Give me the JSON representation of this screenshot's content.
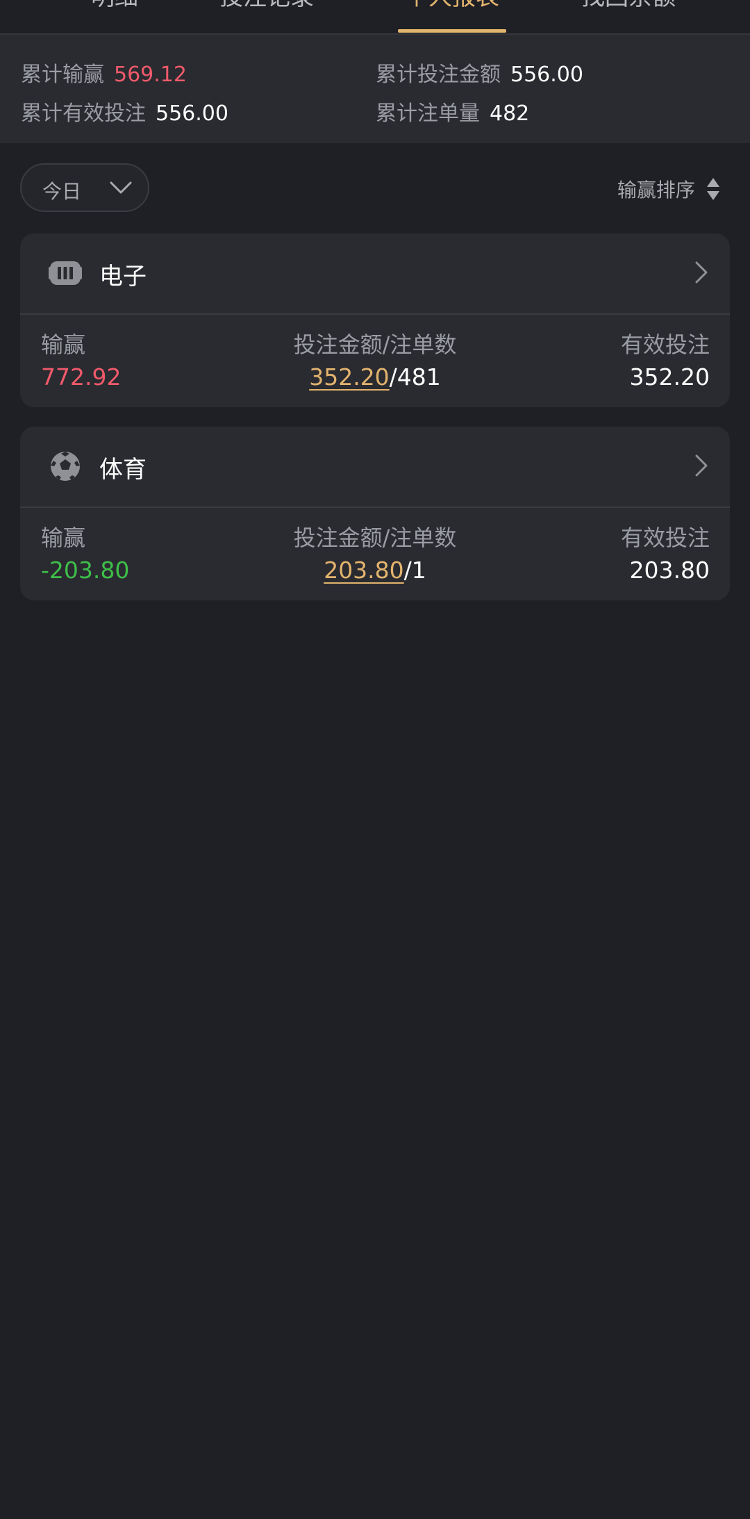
{
  "tabs": [
    {
      "label": "明细",
      "active": false
    },
    {
      "label": "投注记录",
      "active": false
    },
    {
      "label": "个人报表",
      "active": true
    },
    {
      "label": "找回余额",
      "active": false
    }
  ],
  "summary": {
    "total_win_loss_label": "累计输赢",
    "total_win_loss_value": "569.12",
    "total_bet_label": "累计投注金额",
    "total_bet_value": "556.00",
    "total_valid_bet_label": "累计有效投注",
    "total_valid_bet_value": "556.00",
    "total_orders_label": "累计注单量",
    "total_orders_value": "482"
  },
  "filter": {
    "date_label": "今日",
    "sort_label": "输赢排序"
  },
  "cards": [
    {
      "icon": "slot-machine-icon",
      "title": "电子",
      "win_loss_label": "输赢",
      "win_loss_value": "772.92",
      "bet_label": "投注金额/注单数",
      "bet_amount": "352.20",
      "bet_sep_count": "/481",
      "valid_label": "有效投注",
      "valid_value": "352.20"
    },
    {
      "icon": "soccer-ball-icon",
      "title": "体育",
      "win_loss_label": "输赢",
      "win_loss_value": "-203.80",
      "bet_label": "投注金额/注单数",
      "bet_amount": "203.80",
      "bet_sep_count": "/1",
      "valid_label": "有效投注",
      "valid_value": "203.80"
    }
  ],
  "colors": {
    "accent": "#e3b46e",
    "positive": "#f05a6b",
    "negative": "#3fbf4a",
    "background": "#1f2025",
    "card": "#2a2b30"
  }
}
